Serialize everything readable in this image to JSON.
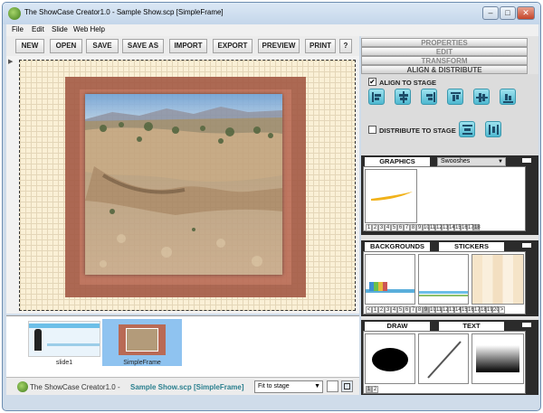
{
  "window": {
    "title": "The ShowCase Creator1.0 - Sample Show.scp [SimpleFrame]",
    "controls": {
      "minimize": "–",
      "maximize": "□",
      "close": "✕"
    }
  },
  "menu": [
    "File",
    "Edit",
    "Slide",
    "Web Help"
  ],
  "toolbar": [
    "NEW",
    "OPEN",
    "SAVE",
    "SAVE AS",
    "IMPORT",
    "EXPORT",
    "PREVIEW",
    "PRINT",
    "?"
  ],
  "slides": [
    {
      "label": "slide1"
    },
    {
      "label": "SimpleFrame"
    }
  ],
  "status": {
    "app": "The ShowCase Creator1.0 -",
    "file": "Sample Show.scp [SimpleFrame]",
    "zoom": "Fit to stage"
  },
  "panel": {
    "accordion": [
      "PROPERTIES",
      "EDIT",
      "TRANSFORM",
      "ALIGN & DISTRIBUTE"
    ],
    "align_to_stage": "ALIGN TO STAGE",
    "align_checked_mark": "✔",
    "distribute_to_stage": "DISTRIBUTE TO STAGE"
  },
  "graphics": {
    "tab": "GRAPHICS",
    "category": "Swooshes",
    "pages": [
      "1",
      "2",
      "3",
      "4",
      "5",
      "6",
      "7",
      "8",
      "9",
      "10",
      "11",
      "12",
      "13",
      "14",
      "15",
      "16",
      "17",
      "18"
    ]
  },
  "backgrounds": {
    "tabs": [
      "BACKGROUNDS",
      "STICKERS"
    ],
    "prev": "<",
    "next": ">",
    "pages": [
      "1",
      "2",
      "3",
      "4",
      "5",
      "6",
      "7",
      "8",
      "9",
      "10",
      "11",
      "12",
      "13",
      "14",
      "15",
      "16",
      "17",
      "18",
      "19",
      "20"
    ]
  },
  "draw": {
    "tabs": [
      "DRAW",
      "TEXT"
    ],
    "pages": [
      "1",
      "2"
    ]
  }
}
